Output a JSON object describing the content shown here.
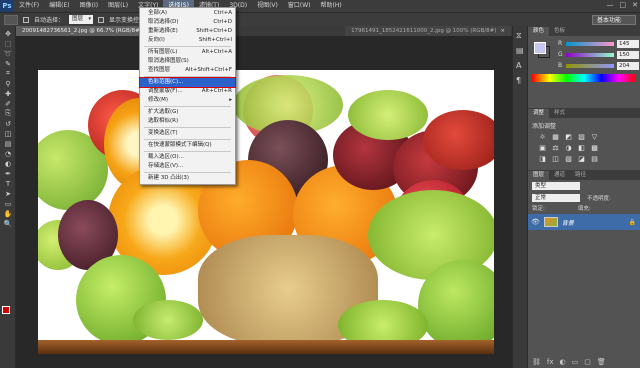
{
  "app": {
    "logo": "Ps"
  },
  "menubar": {
    "items": [
      "文件(F)",
      "编辑(E)",
      "图像(I)",
      "图层(L)",
      "文字(Y)",
      "选择(S)",
      "滤镜(T)",
      "3D(D)",
      "视图(V)",
      "窗口(W)",
      "帮助(H)"
    ],
    "active_index": 5,
    "window_controls": [
      "—",
      "□",
      "✕"
    ]
  },
  "options": {
    "auto_select_label": "自动选择：",
    "auto_select_value": "图层",
    "show_transform_label": "显示变换控件",
    "workspace": "基本功能"
  },
  "tabs": [
    {
      "label": "20091482736561_2.jpg @ 66.7% (RGB/8#) *",
      "active": true,
      "close": "×"
    },
    {
      "label": "17961491_1852421611000_2.jpg @ 100% (RGB/8#)",
      "active": false,
      "close": "×"
    }
  ],
  "toolbar": {
    "icons": [
      "move-icon",
      "marquee-icon",
      "lasso-icon",
      "quick-select-icon",
      "crop-icon",
      "eyedropper-icon",
      "healing-icon",
      "brush-icon",
      "stamp-icon",
      "history-brush-icon",
      "eraser-icon",
      "gradient-icon",
      "blur-icon",
      "dodge-icon",
      "pen-icon",
      "type-icon",
      "path-select-icon",
      "shape-icon",
      "hand-icon",
      "zoom-icon"
    ],
    "glyphs": [
      "✥",
      "⬚",
      "➰",
      "✎",
      "⌗",
      "⚲",
      "✚",
      "✐",
      "⎘",
      "↺",
      "◫",
      "▤",
      "◔",
      "◐",
      "✒",
      "T",
      "➤",
      "▭",
      "✋",
      "🔍"
    ]
  },
  "select_menu": {
    "items": [
      {
        "label": "全部(A)",
        "shortcut": "Ctrl+A",
        "sep_after": false,
        "disabled": false
      },
      {
        "label": "取消选择(D)",
        "shortcut": "Ctrl+D",
        "sep_after": false,
        "disabled": false
      },
      {
        "label": "重新选择(E)",
        "shortcut": "Shift+Ctrl+D",
        "sep_after": false,
        "disabled": false
      },
      {
        "label": "反向(I)",
        "shortcut": "Shift+Ctrl+I",
        "sep_after": true,
        "disabled": false
      },
      {
        "label": "所有图层(L)",
        "shortcut": "Alt+Ctrl+A",
        "sep_after": false,
        "disabled": false
      },
      {
        "label": "取消选择图层(S)",
        "shortcut": "",
        "sep_after": false,
        "disabled": false
      },
      {
        "label": "查找图层",
        "shortcut": "Alt+Shift+Ctrl+F",
        "sep_after": true,
        "disabled": false
      },
      {
        "label": "色彩范围(C)...",
        "shortcut": "",
        "sep_after": false,
        "disabled": false,
        "highlight": true
      },
      {
        "label": "调整蒙版(F)...",
        "shortcut": "Alt+Ctrl+R",
        "sep_after": false,
        "disabled": false
      },
      {
        "label": "修改(M)",
        "shortcut": "▸",
        "sep_after": true,
        "disabled": false
      },
      {
        "label": "扩大选取(G)",
        "shortcut": "",
        "sep_after": false,
        "disabled": false
      },
      {
        "label": "选取相似(R)",
        "shortcut": "",
        "sep_after": true,
        "disabled": false
      },
      {
        "label": "变换选区(T)",
        "shortcut": "",
        "sep_after": true,
        "disabled": false
      },
      {
        "label": "在快速蒙版模式下编辑(Q)",
        "shortcut": "",
        "sep_after": true,
        "disabled": false
      },
      {
        "label": "载入选区(O)...",
        "shortcut": "",
        "sep_after": false,
        "disabled": false
      },
      {
        "label": "存储选区(V)...",
        "shortcut": "",
        "sep_after": true,
        "disabled": false
      },
      {
        "label": "新建 3D 凸出(3)",
        "shortcut": "",
        "sep_after": false,
        "disabled": false
      }
    ]
  },
  "color_panel": {
    "tabs": [
      "颜色",
      "色板"
    ],
    "sliders": [
      {
        "label": "R",
        "value": "145"
      },
      {
        "label": "G",
        "value": "150"
      },
      {
        "label": "B",
        "value": "204"
      }
    ],
    "fg_color": "#c6c6f0"
  },
  "adjust_panel": {
    "tabs": [
      "调整",
      "样式"
    ],
    "title": "添加调整",
    "icons": [
      "☼",
      "▦",
      "◩",
      "▨",
      "▽",
      "▣",
      "⚖",
      "◑",
      "◧",
      "▩",
      "◨",
      "◫",
      "▧",
      "◪",
      "▤"
    ]
  },
  "layers_panel": {
    "tabs": [
      "图层",
      "通道",
      "路径"
    ],
    "kind": "类型",
    "blend": "正常",
    "opacity_label": "不透明度:",
    "lock_label": "锁定:",
    "fill_label": "填充:",
    "layer_name": "背景",
    "bottom_icons": [
      "⛓",
      "fx",
      "◐",
      "▭",
      "▢",
      "🗑"
    ]
  }
}
